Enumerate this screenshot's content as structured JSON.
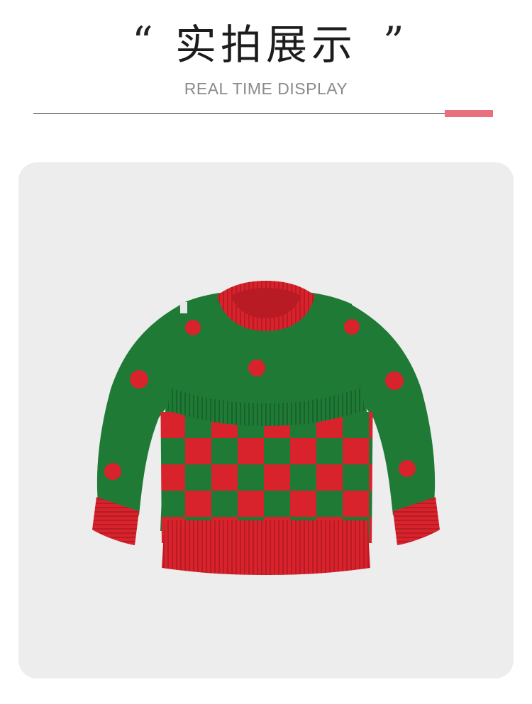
{
  "header": {
    "quote_open": "“",
    "title_cn": "实拍展示",
    "quote_close": "”",
    "title_en": "REAL TIME DISPLAY"
  },
  "colors": {
    "accent": "#e9717f",
    "card_background": "#ededed",
    "sweater_green": "#1f7a36",
    "sweater_red": "#d8232c"
  },
  "photo": {
    "subject": "sweater-photo"
  }
}
